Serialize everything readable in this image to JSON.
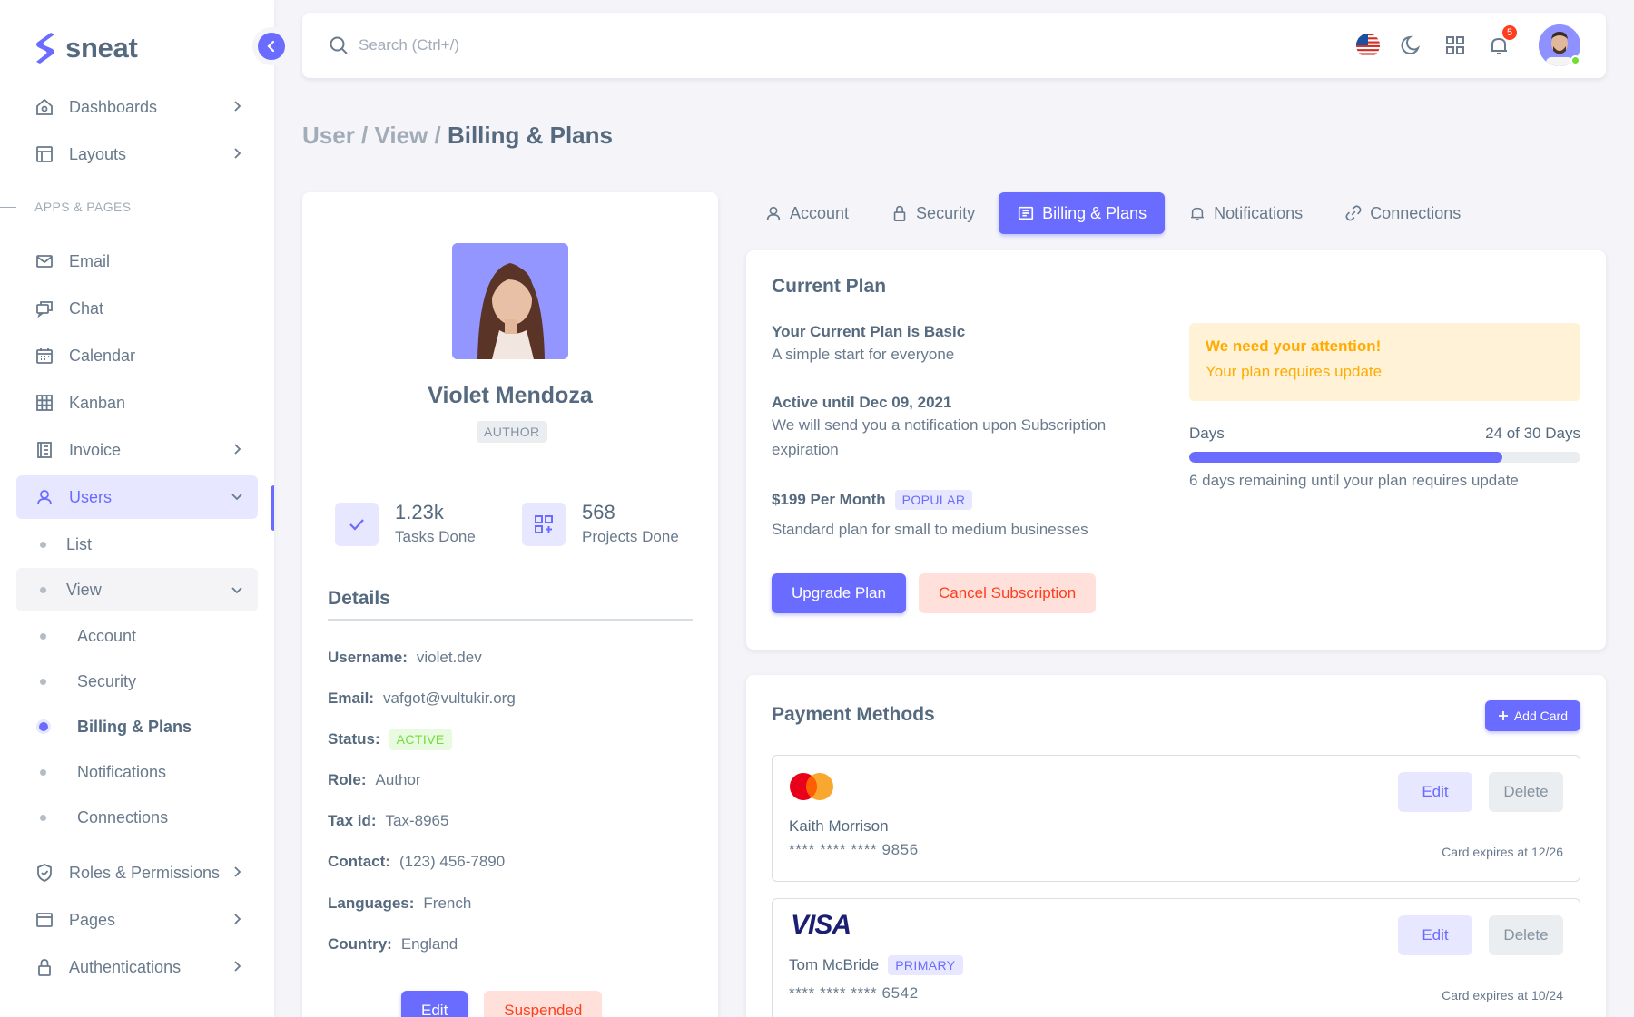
{
  "brand": {
    "name": "sneat"
  },
  "colors": {
    "accent": "#696cff",
    "warning": "#ffab00",
    "danger": "#ff3e1d",
    "success": "#71dd37"
  },
  "sidebar": {
    "items_top": [
      {
        "label": "Dashboards",
        "icon": "home-icon"
      },
      {
        "label": "Layouts",
        "icon": "layout-icon"
      }
    ],
    "section_header": "APPS & PAGES",
    "apps": [
      {
        "label": "Email",
        "icon": "mail-icon"
      },
      {
        "label": "Chat",
        "icon": "chat-icon"
      },
      {
        "label": "Calendar",
        "icon": "calendar-icon"
      },
      {
        "label": "Kanban",
        "icon": "grid-icon"
      },
      {
        "label": "Invoice",
        "icon": "invoice-icon"
      },
      {
        "label": "Users",
        "icon": "user-icon"
      }
    ],
    "users_sub": {
      "list": "List",
      "view": "View"
    },
    "view_sub": [
      "Account",
      "Security",
      "Billing & Plans",
      "Notifications",
      "Connections"
    ],
    "items_bottom": [
      {
        "label": "Roles & Permissions",
        "icon": "shield-check-icon"
      },
      {
        "label": "Pages",
        "icon": "pages-icon"
      },
      {
        "label": "Authentications",
        "icon": "lock-icon"
      }
    ]
  },
  "navbar": {
    "search_placeholder": "Search (Ctrl+/)",
    "notification_count": "5"
  },
  "breadcrumb": {
    "part1": "User / ",
    "part2": "View / ",
    "current": "Billing & Plans"
  },
  "user": {
    "name": "Violet Mendoza",
    "role_badge": "AUTHOR",
    "tasks_value": "1.23k",
    "tasks_label": "Tasks Done",
    "projects_value": "568",
    "projects_label": "Projects Done",
    "details_title": "Details",
    "details": {
      "username_k": "Username:",
      "username_v": "violet.dev",
      "email_k": "Email:",
      "email_v": "vafgot@vultukir.org",
      "status_k": "Status:",
      "status_v": "ACTIVE",
      "role_k": "Role:",
      "role_v": "Author",
      "tax_k": "Tax id:",
      "tax_v": "Tax-8965",
      "contact_k": "Contact:",
      "contact_v": "(123) 456-7890",
      "languages_k": "Languages:",
      "languages_v": "French",
      "country_k": "Country:",
      "country_v": "England"
    },
    "edit_label": "Edit",
    "suspend_label": "Suspended"
  },
  "tabs": [
    {
      "label": "Account",
      "icon": "user-icon"
    },
    {
      "label": "Security",
      "icon": "lock-icon"
    },
    {
      "label": "Billing & Plans",
      "icon": "receipt-icon"
    },
    {
      "label": "Notifications",
      "icon": "bell-icon"
    },
    {
      "label": "Connections",
      "icon": "link-icon"
    }
  ],
  "plan": {
    "title": "Current Plan",
    "current_line": "Your Current Plan is Basic",
    "current_desc": "A simple start for everyone",
    "active_line": "Active until Dec 09, 2021",
    "active_desc": "We will send you a notification upon Subscription expiration",
    "price_line": "$199 Per Month",
    "popular_badge": "POPULAR",
    "price_desc": "Standard plan for small to medium businesses",
    "alert_title": "We need your attention!",
    "alert_text": "Your plan requires update",
    "days_label": "Days",
    "days_value": "24 of 30 Days",
    "days_progress": 0.8,
    "days_note": "6 days remaining until your plan requires update",
    "upgrade_label": "Upgrade Plan",
    "cancel_label": "Cancel Subscription"
  },
  "payment": {
    "title": "Payment Methods",
    "add_label": "Add Card",
    "cards": [
      {
        "brand": "mastercard",
        "name": "Kaith Morrison",
        "number": "**** **** **** 9856",
        "expiry": "Card expires at 12/26",
        "edit": "Edit",
        "delete": "Delete"
      },
      {
        "brand": "VISA",
        "name": "Tom McBride",
        "badge": "PRIMARY",
        "number": "**** **** **** 6542",
        "expiry": "Card expires at 10/24",
        "edit": "Edit",
        "delete": "Delete"
      }
    ]
  }
}
